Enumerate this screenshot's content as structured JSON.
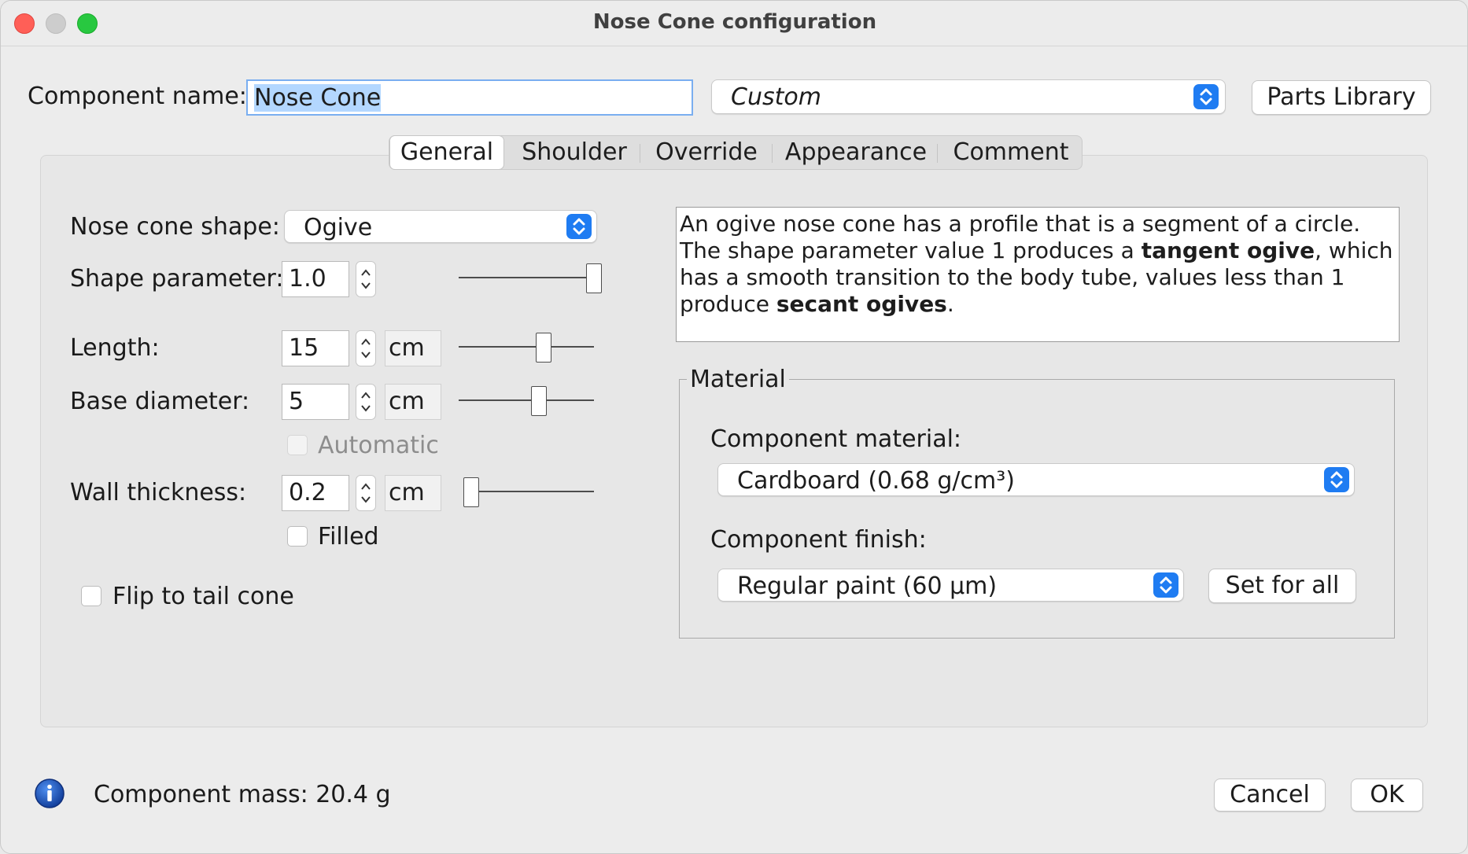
{
  "window": {
    "title": "Nose Cone configuration"
  },
  "header": {
    "component_name_label": "Component name:",
    "component_name_value": "Nose Cone",
    "preset_value": "Custom",
    "parts_library_label": "Parts Library"
  },
  "tabs": [
    {
      "label": "General"
    },
    {
      "label": "Shoulder"
    },
    {
      "label": "Override"
    },
    {
      "label": "Appearance"
    },
    {
      "label": "Comment"
    }
  ],
  "general": {
    "shape_label": "Nose cone shape:",
    "shape_value": "Ogive",
    "shape_param_label": "Shape parameter:",
    "shape_param_value": "1.0",
    "length_label": "Length:",
    "length_value": "15",
    "length_unit": "cm",
    "base_diameter_label": "Base diameter:",
    "base_diameter_value": "5",
    "base_diameter_unit": "cm",
    "automatic_label": "Automatic",
    "wall_thickness_label": "Wall thickness:",
    "wall_thickness_value": "0.2",
    "wall_thickness_unit": "cm",
    "filled_label": "Filled",
    "flip_label": "Flip to tail cone"
  },
  "description": {
    "part1": "An ogive nose cone has a profile that is a segment of a circle. The shape parameter value 1 produces a ",
    "bold1": "tangent ogive",
    "part2": ", which has a smooth transition to the body tube, values less than 1 produce ",
    "bold2": "secant ogives",
    "part3": "."
  },
  "material": {
    "legend": "Material",
    "component_material_label": "Component material:",
    "component_material_value": "Cardboard (0.68 g/cm³)",
    "component_finish_label": "Component finish:",
    "component_finish_value": "Regular paint (60 µm)",
    "set_for_all_label": "Set for all"
  },
  "footer": {
    "mass_text": "Component mass: 20.4 g",
    "cancel_label": "Cancel",
    "ok_label": "OK"
  },
  "sliders": {
    "shape_parameter": 1.0,
    "length": 0.62,
    "base_diameter": 0.59,
    "wall_thickness": 0.08
  },
  "colors": {
    "close": "#ff5f57",
    "minimize": "#c8c8c8",
    "zoom": "#28c840",
    "accent": "#1f7cf2",
    "selection": "#b3d7ff"
  }
}
